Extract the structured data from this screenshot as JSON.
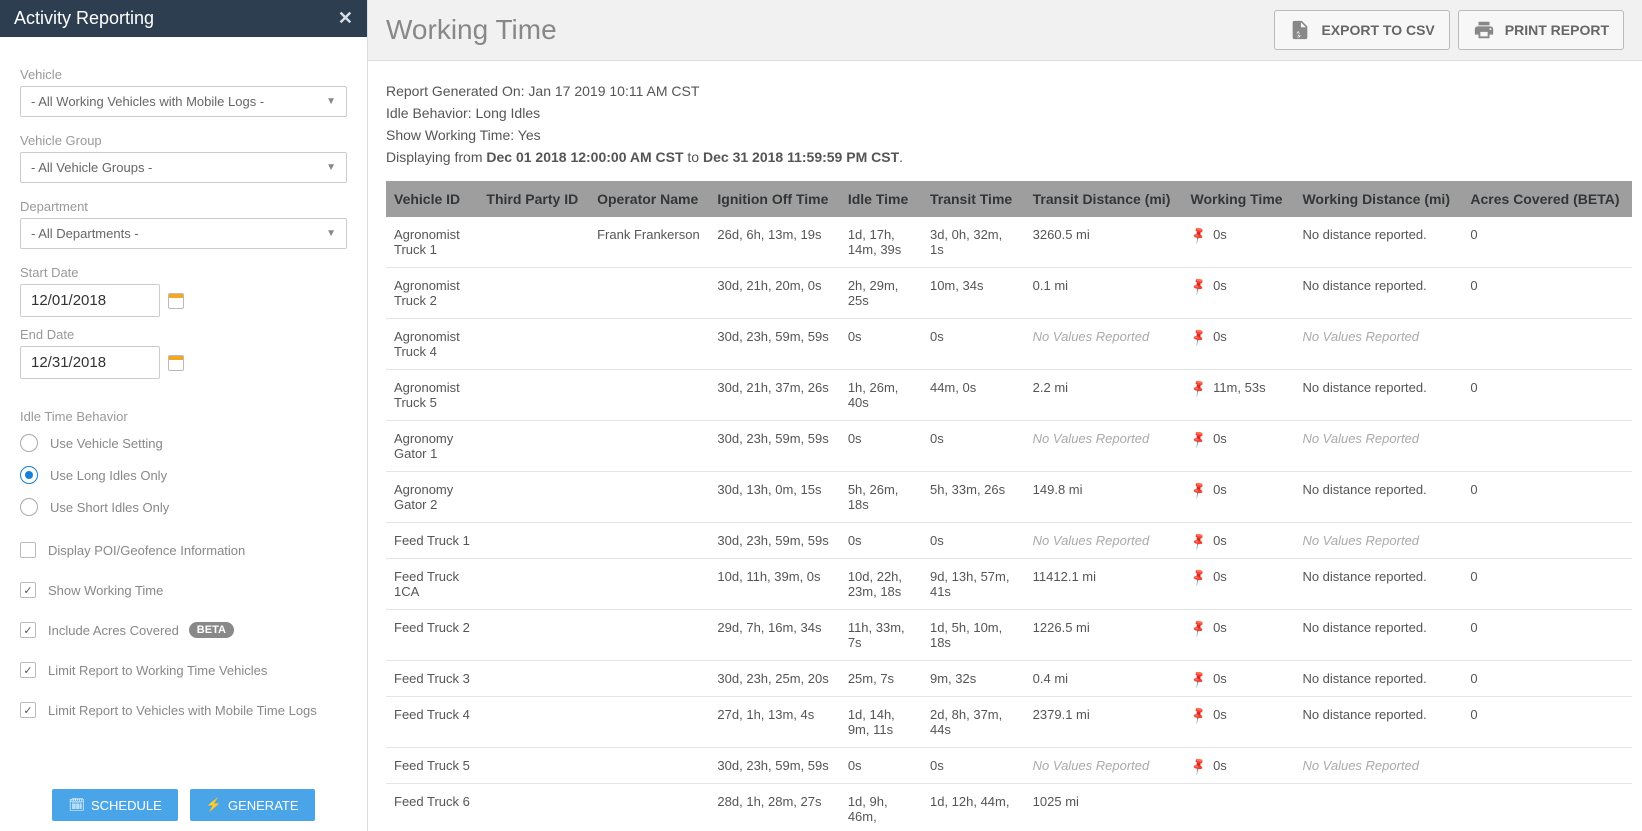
{
  "sidebar": {
    "title": "Activity Reporting",
    "fields": {
      "vehicle_label": "Vehicle",
      "vehicle_value": "- All Working Vehicles with Mobile Logs -",
      "vehicle_group_label": "Vehicle Group",
      "vehicle_group_value": "- All Vehicle Groups -",
      "department_label": "Department",
      "department_value": "- All Departments -",
      "start_date_label": "Start Date",
      "start_date_value": "12/01/2018",
      "end_date_label": "End Date",
      "end_date_value": "12/31/2018"
    },
    "idle_heading": "Idle Time Behavior",
    "idle_options": {
      "use_vehicle": "Use Vehicle Setting",
      "use_long": "Use Long Idles Only",
      "use_short": "Use Short Idles Only"
    },
    "checks": {
      "display_poi": "Display POI/Geofence Information",
      "show_wt": "Show Working Time",
      "include_acres": "Include Acres Covered",
      "beta": "BETA",
      "limit_wt": "Limit Report to Working Time Vehicles",
      "limit_mobile": "Limit Report to Vehicles with Mobile Time Logs"
    },
    "buttons": {
      "schedule": "SCHEDULE",
      "generate": "GENERATE"
    }
  },
  "main": {
    "title": "Working Time",
    "export_csv": "EXPORT TO CSV",
    "print_report": "PRINT REPORT",
    "meta": {
      "generated_label": "Report Generated On: ",
      "generated_value": "Jan 17 2019 10:11 AM CST",
      "idle_label": "Idle Behavior: ",
      "idle_value": "Long Idles",
      "show_wt_label": "Show Working Time: ",
      "show_wt_value": "Yes",
      "disp_prefix": "Displaying from ",
      "disp_from": "Dec 01 2018 12:00:00 AM CST",
      "disp_to_word": " to ",
      "disp_to": "Dec 31 2018 11:59:59 PM CST",
      "period": "."
    },
    "columns": {
      "vehicle_id": "Vehicle ID",
      "third_party": "Third Party ID",
      "operator": "Operator Name",
      "ignition_off": "Ignition Off Time",
      "idle_time": "Idle Time",
      "transit_time": "Transit Time",
      "transit_dist": "Transit Distance (mi)",
      "working_time": "Working Time",
      "working_dist": "Working Distance (mi)",
      "acres": "Acres Covered (BETA)"
    },
    "no_values": "No Values Reported",
    "no_distance": "No distance reported.",
    "rows": [
      {
        "vehicle": "Agronomist Truck 1",
        "third": "",
        "op": "Frank Frankerson",
        "ign": "26d, 6h, 13m, 19s",
        "idle": "1d, 17h, 14m, 39s",
        "transit": "3d, 0h, 32m, 1s",
        "tdist": "3260.5 mi",
        "wtime": "0s",
        "wdist": "No distance reported.",
        "acres": "0"
      },
      {
        "vehicle": "Agronomist Truck 2",
        "third": "",
        "op": "",
        "ign": "30d, 21h, 20m, 0s",
        "idle": "2h, 29m, 25s",
        "transit": "10m, 34s",
        "tdist": "0.1 mi",
        "wtime": "0s",
        "wdist": "No distance reported.",
        "acres": "0"
      },
      {
        "vehicle": "Agronomist Truck 4",
        "third": "",
        "op": "",
        "ign": "30d, 23h, 59m, 59s",
        "idle": "0s",
        "transit": "0s",
        "tdist": "NO_VALUES",
        "wtime": "0s",
        "wdist": "NO_VALUES",
        "acres": ""
      },
      {
        "vehicle": "Agronomist Truck 5",
        "third": "",
        "op": "",
        "ign": "30d, 21h, 37m, 26s",
        "idle": "1h, 26m, 40s",
        "transit": "44m, 0s",
        "tdist": "2.2 mi",
        "wtime": "11m, 53s",
        "wdist": "No distance reported.",
        "acres": "0"
      },
      {
        "vehicle": "Agronomy Gator 1",
        "third": "",
        "op": "",
        "ign": "30d, 23h, 59m, 59s",
        "idle": "0s",
        "transit": "0s",
        "tdist": "NO_VALUES",
        "wtime": "0s",
        "wdist": "NO_VALUES",
        "acres": ""
      },
      {
        "vehicle": "Agronomy Gator 2",
        "third": "",
        "op": "",
        "ign": "30d, 13h, 0m, 15s",
        "idle": "5h, 26m, 18s",
        "transit": "5h, 33m, 26s",
        "tdist": "149.8 mi",
        "wtime": "0s",
        "wdist": "No distance reported.",
        "acres": "0"
      },
      {
        "vehicle": "Feed Truck 1",
        "third": "",
        "op": "",
        "ign": "30d, 23h, 59m, 59s",
        "idle": "0s",
        "transit": "0s",
        "tdist": "NO_VALUES",
        "wtime": "0s",
        "wdist": "NO_VALUES",
        "acres": ""
      },
      {
        "vehicle": "Feed Truck 1CA",
        "third": "",
        "op": "",
        "ign": "10d, 11h, 39m, 0s",
        "idle": "10d, 22h, 23m, 18s",
        "transit": "9d, 13h, 57m, 41s",
        "tdist": "11412.1 mi",
        "wtime": "0s",
        "wdist": "No distance reported.",
        "acres": "0"
      },
      {
        "vehicle": "Feed Truck 2",
        "third": "",
        "op": "",
        "ign": "29d, 7h, 16m, 34s",
        "idle": "11h, 33m, 7s",
        "transit": "1d, 5h, 10m, 18s",
        "tdist": "1226.5 mi",
        "wtime": "0s",
        "wdist": "No distance reported.",
        "acres": "0"
      },
      {
        "vehicle": "Feed Truck 3",
        "third": "",
        "op": "",
        "ign": "30d, 23h, 25m, 20s",
        "idle": "25m, 7s",
        "transit": "9m, 32s",
        "tdist": "0.4 mi",
        "wtime": "0s",
        "wdist": "No distance reported.",
        "acres": "0"
      },
      {
        "vehicle": "Feed Truck 4",
        "third": "",
        "op": "",
        "ign": "27d, 1h, 13m, 4s",
        "idle": "1d, 14h, 9m, 11s",
        "transit": "2d, 8h, 37m, 44s",
        "tdist": "2379.1 mi",
        "wtime": "0s",
        "wdist": "No distance reported.",
        "acres": "0"
      },
      {
        "vehicle": "Feed Truck 5",
        "third": "",
        "op": "",
        "ign": "30d, 23h, 59m, 59s",
        "idle": "0s",
        "transit": "0s",
        "tdist": "NO_VALUES",
        "wtime": "0s",
        "wdist": "NO_VALUES",
        "acres": ""
      },
      {
        "vehicle": "Feed Truck 6",
        "third": "",
        "op": "",
        "ign": "28d, 1h, 28m, 27s",
        "idle": "1d, 9h, 46m,",
        "transit": "1d, 12h, 44m,",
        "tdist": "1025 mi",
        "wtime": "",
        "wdist": "",
        "acres": ""
      }
    ]
  }
}
